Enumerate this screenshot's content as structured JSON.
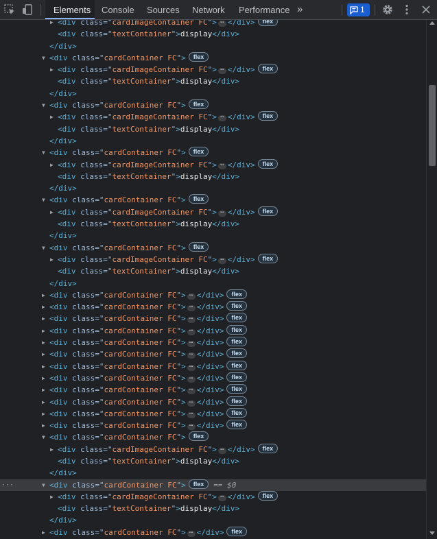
{
  "toolbar": {
    "tabs": [
      {
        "label": "Elements"
      },
      {
        "label": "Console"
      },
      {
        "label": "Sources"
      },
      {
        "label": "Network"
      },
      {
        "label": "Performance"
      }
    ],
    "more_tabs": "»",
    "issues_count": "1",
    "icons": [
      "inspect-element-icon",
      "device-toolbar-icon",
      "issues-message-icon",
      "settings-gear-icon",
      "kebab-menu-icon",
      "close-icon"
    ]
  },
  "tree": {
    "tag_div": "div",
    "attr_class": "class",
    "card_container": "cardContainer FC",
    "card_image_container": "cardImageContainer FC",
    "text_container": "textContainer",
    "text_value": "display",
    "pill": "flex",
    "ellipsis": "⋯",
    "selected_suffix_eq": "==",
    "selected_suffix_var": "$0",
    "gutter_dots": "···"
  },
  "colors": {
    "background": "#202124",
    "toolbar": "#292a2d",
    "tag": "#5db0d7",
    "attribute_name": "#9bbbdc",
    "attribute_value": "#f29766",
    "selected_row": "#393b3f",
    "accent": "#8ab4f8"
  }
}
